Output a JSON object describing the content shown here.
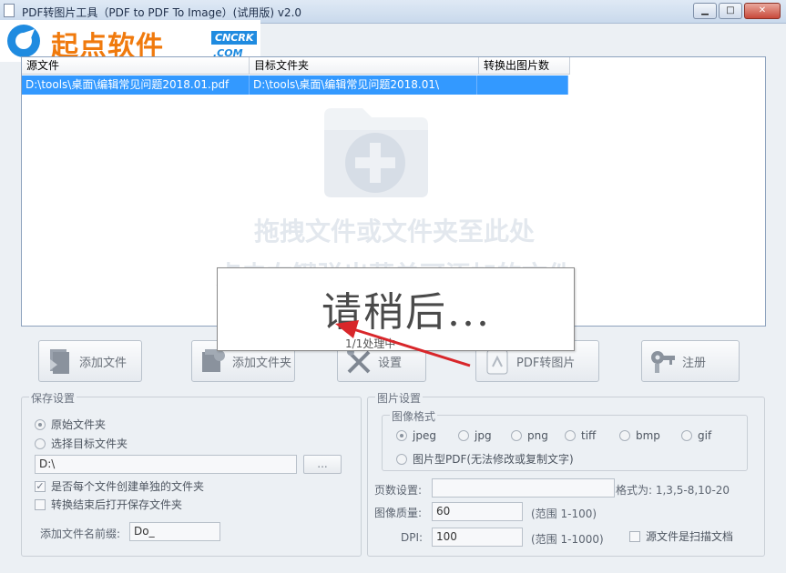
{
  "window": {
    "title": "PDF转图片工具（PDF to PDF To Image）(试用版) v2.0",
    "minimize": "▁",
    "maximize": "□",
    "close": "✕"
  },
  "watermark": {
    "text": "起点软件",
    "badge": "CNCRK",
    "domain": ".COM"
  },
  "list": {
    "columns": [
      "源文件",
      "目标文件夹",
      "转换出图片数"
    ],
    "rows": [
      [
        "D:\\tools\\桌面\\编辑常见问题2018.01.pdf",
        "D:\\tools\\桌面\\编辑常见问题2018.01\\",
        ""
      ]
    ],
    "drop_hint_1": "拖拽文件或文件夹至此处",
    "drop_hint_2": "点击右键弹出菜单可添加的文件"
  },
  "wait": {
    "message": "请稍后...",
    "progress": "1/1处理中"
  },
  "toolbar": {
    "add_file": "添加文件",
    "add_folder": "添加文件夹",
    "settings": "设置",
    "convert": "PDF转图片",
    "register": "注册"
  },
  "save_settings": {
    "title": "保存设置",
    "opt_original": "原始文件夹",
    "opt_target": "选择目标文件夹",
    "path_value": "D:\\",
    "browse": "...",
    "chk_separate": "是否每个文件创建单独的文件夹",
    "chk_open": "转换结束后打开保存文件夹",
    "prefix_label": "添加文件名前缀:",
    "prefix_value": "Do_"
  },
  "image_settings": {
    "title": "图片设置",
    "format_title": "图像格式",
    "formats": [
      "jpeg",
      "jpg",
      "png",
      "tiff",
      "bmp",
      "gif"
    ],
    "selected_format": "jpeg",
    "pdf_image": "图片型PDF(无法修改或复制文字)",
    "pages_label": "页数设置:",
    "pages_value": "",
    "pages_hint": "格式为: 1,3,5-8,10-20",
    "quality_label": "图像质量:",
    "quality_value": "60",
    "quality_range": "(范围 1-100)",
    "dpi_label": "DPI:",
    "dpi_value": "100",
    "dpi_range": "(范围 1-1000)",
    "scan_label": "源文件是扫描文档"
  },
  "colors": {
    "selection": "#3399ff",
    "watermark_orange": "#f07a0d",
    "watermark_blue": "#1f8be0",
    "arrow": "#d8262a"
  }
}
